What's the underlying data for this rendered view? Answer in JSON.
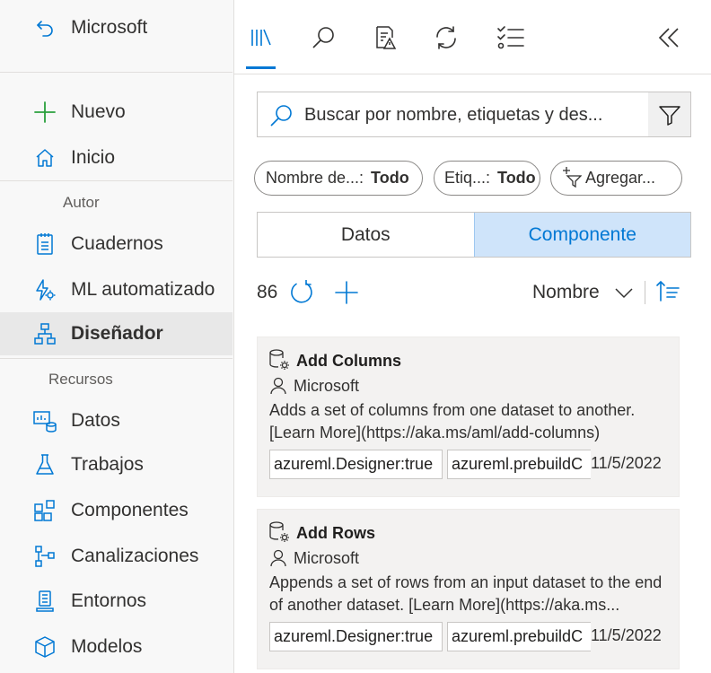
{
  "nav": {
    "back_label": "Microsoft",
    "new_label": "Nuevo",
    "home_label": "Inicio",
    "section_author": "Autor",
    "notebooks_label": "Cuadernos",
    "automl_label": "ML automatizado",
    "designer_label": "Diseñador",
    "section_resources": "Recursos",
    "data_label": "Datos",
    "jobs_label": "Trabajos",
    "components_label": "Componentes",
    "pipelines_label": "Canalizaciones",
    "environments_label": "Entornos",
    "models_label": "Modelos"
  },
  "search": {
    "placeholder": "Buscar por nombre, etiquetas y des..."
  },
  "filters": {
    "name_key": "Nombre de...:",
    "name_value": "Todo",
    "tags_key": "Etiq...:",
    "tags_value": "Todo",
    "add_label": "Agregar..."
  },
  "segments": {
    "data": "Datos",
    "component": "Componente"
  },
  "list": {
    "count": "86",
    "sort_label": "Nombre"
  },
  "cards": [
    {
      "title": "Add Columns",
      "author": "Microsoft",
      "description": "Adds a set of columns from one dataset to another. [Learn More](https://aka.ms/aml/add-columns)",
      "tag1": "azureml.Designer:true",
      "tag2": "azureml.prebuildC",
      "date": "11/5/2022"
    },
    {
      "title": "Add Rows",
      "author": "Microsoft",
      "description": "Appends a set of rows from an input dataset to the end of another dataset. [Learn More](https://aka.ms...",
      "tag1": "azureml.Designer:true",
      "tag2": "azureml.prebuildC",
      "date": "11/5/2022"
    }
  ],
  "colors": {
    "accent": "#0078d4",
    "selected_segment_bg": "#cfe4fa",
    "nav_bg": "#f8f8f8",
    "card_bg": "#f3f2f1"
  }
}
